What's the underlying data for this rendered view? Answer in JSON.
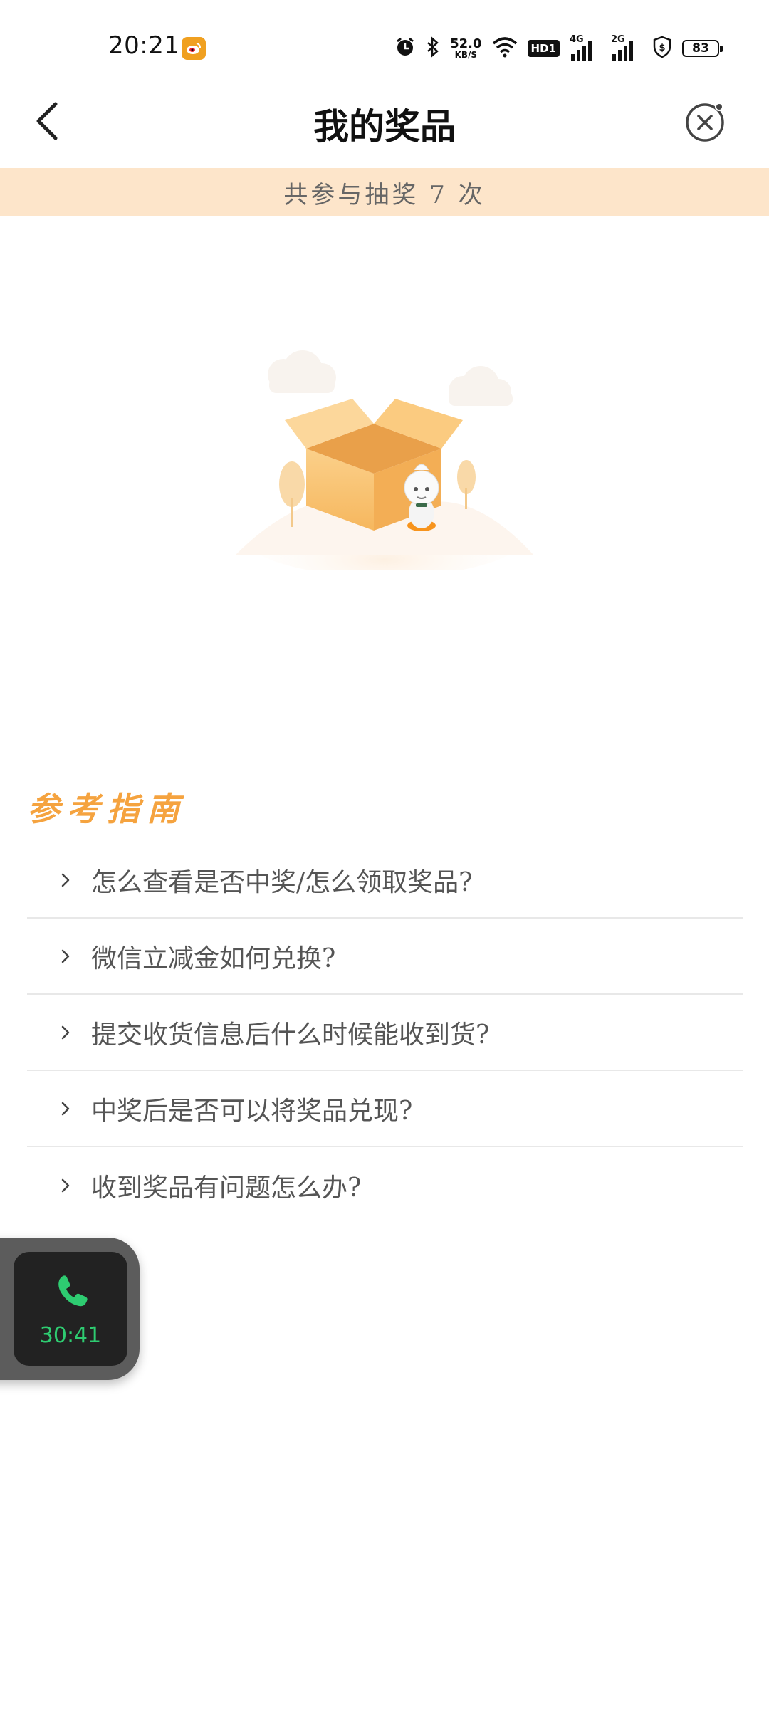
{
  "status_bar": {
    "time": "20:21",
    "net_speed_value": "52.0",
    "net_speed_unit": "KB/S",
    "hd_label": "HD1",
    "signal_1_label": "4G",
    "signal_2_label": "2G",
    "battery_level": "83",
    "icons": [
      "weibo-icon",
      "alarm-icon",
      "bluetooth-icon",
      "wifi-icon",
      "signal-icon",
      "dollar-shield-icon",
      "battery-icon"
    ]
  },
  "nav": {
    "title": "我的奖品",
    "back_icon": "back-arrow-icon",
    "close_icon": "close-mini-program-icon"
  },
  "summary": {
    "text": "共参与抽奖 7 次"
  },
  "illustration": {
    "description_icon": "empty-prize-box-illustration"
  },
  "guide": {
    "title": "参考指南",
    "items": [
      {
        "label": "怎么查看是否中奖/怎么领取奖品?"
      },
      {
        "label": "微信立减金如何兑换?"
      },
      {
        "label": "提交收货信息后什么时候能收到货?"
      },
      {
        "label": "中奖后是否可以将奖品兑现?"
      },
      {
        "label": "收到奖品有问题怎么办?"
      }
    ]
  },
  "call_bubble": {
    "timer": "30:41",
    "icon": "phone-icon"
  },
  "colors": {
    "banner_bg": "#fde5ca",
    "guide_title": "#f5a33f",
    "call_green": "#2ecc71"
  }
}
